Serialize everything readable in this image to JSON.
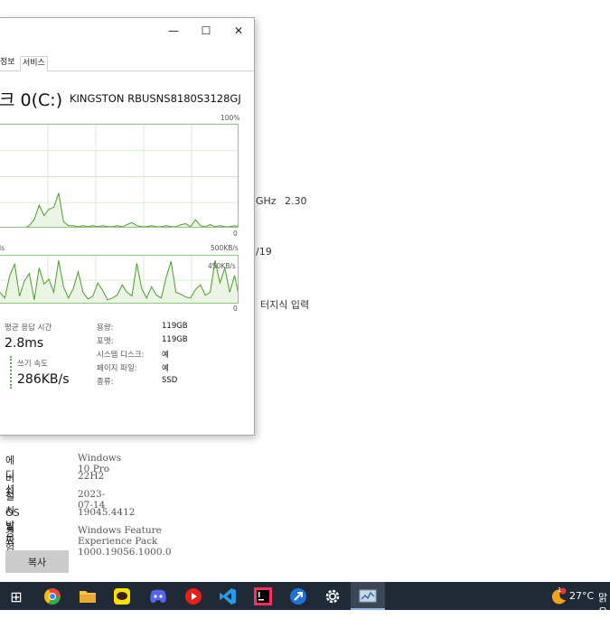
{
  "background": {
    "frag_ghz": "GHz",
    "frag_ghz_val": "2.30",
    "frag_19": "/19",
    "frag_input": "터지식 입력",
    "specs": [
      {
        "label": "에디션",
        "value": "Windows 10 Pro"
      },
      {
        "label": "버전",
        "value": "22H2"
      },
      {
        "label": "설치 날짜",
        "value": "2023-07-14"
      },
      {
        "label": "OS 빌드",
        "value": "19045.4412"
      },
      {
        "label": "경험",
        "value": "Windows Feature Experience Pack 1000.19056.1000.0"
      }
    ],
    "copy_button": "복사"
  },
  "task_manager": {
    "controls": {
      "minimize": "—",
      "maximize": "☐",
      "close": "✕"
    },
    "tabs": [
      {
        "label": "정보",
        "active": false
      },
      {
        "label": "서비스",
        "active": true
      }
    ],
    "disk_title": "크 0(C:)",
    "disk_model": "KINGSTON RBUSNS8180S3128GJ",
    "graph1": {
      "max_label": "100%",
      "min_label": "0",
      "active_time_percent": [
        0,
        0,
        0,
        0,
        0,
        0,
        2,
        8,
        22,
        12,
        18,
        20,
        34,
        6,
        2,
        2,
        1,
        2,
        1,
        2,
        1,
        2,
        1,
        1,
        2,
        1,
        3,
        5,
        2,
        1,
        1,
        2,
        1,
        1,
        2,
        1,
        1,
        3,
        4,
        1,
        8,
        2,
        1,
        3,
        1,
        2,
        1,
        1,
        2,
        1
      ]
    },
    "graph2": {
      "left_label": "ls",
      "max_label": "500KB/s",
      "inner_label": "450KB/s",
      "min_label": "0",
      "transfer_kbps": [
        120,
        60,
        300,
        420,
        80,
        240,
        320,
        40,
        380,
        210,
        260,
        120,
        460,
        180,
        60,
        160,
        340,
        120,
        50,
        80,
        220,
        140,
        40,
        60,
        90,
        200,
        120,
        80,
        430,
        160,
        60,
        180,
        90,
        60,
        280,
        450,
        120,
        100,
        70,
        60,
        150,
        200,
        90,
        120,
        460,
        220,
        380,
        120,
        300,
        50
      ]
    },
    "avg_response_label": "평균 응답 시간",
    "avg_response_value": "2.8ms",
    "write_speed_label": "쓰기 속도",
    "write_speed_value": "286KB/s",
    "details": [
      {
        "label": "용량:",
        "value": "119GB"
      },
      {
        "label": "포맷:",
        "value": "119GB"
      },
      {
        "label": "시스템 디스크:",
        "value": "예"
      },
      {
        "label": "페이지 파일:",
        "value": "예"
      },
      {
        "label": "종류:",
        "value": "SSD"
      }
    ]
  },
  "taskbar": {
    "start_label": "⊞",
    "apps": [
      {
        "name": "chrome",
        "color": "#e8453c"
      },
      {
        "name": "file-explorer",
        "color": "#f4c04e"
      },
      {
        "name": "kakaotalk",
        "color": "#f9e000"
      },
      {
        "name": "discord",
        "color": "#5865f2"
      },
      {
        "name": "media-player",
        "color": "#e62117"
      },
      {
        "name": "vscode",
        "color": "#0078d4"
      },
      {
        "name": "intellij",
        "color": "#000000"
      },
      {
        "name": "pinned-app",
        "color": "#1e73d8"
      },
      {
        "name": "settings",
        "color": "#1f2a36"
      },
      {
        "name": "task-manager",
        "color": "#6b8fb3"
      }
    ],
    "weather_temp": "27°C",
    "weather_text_fragment": "맑음",
    "weather_badge": "1"
  }
}
